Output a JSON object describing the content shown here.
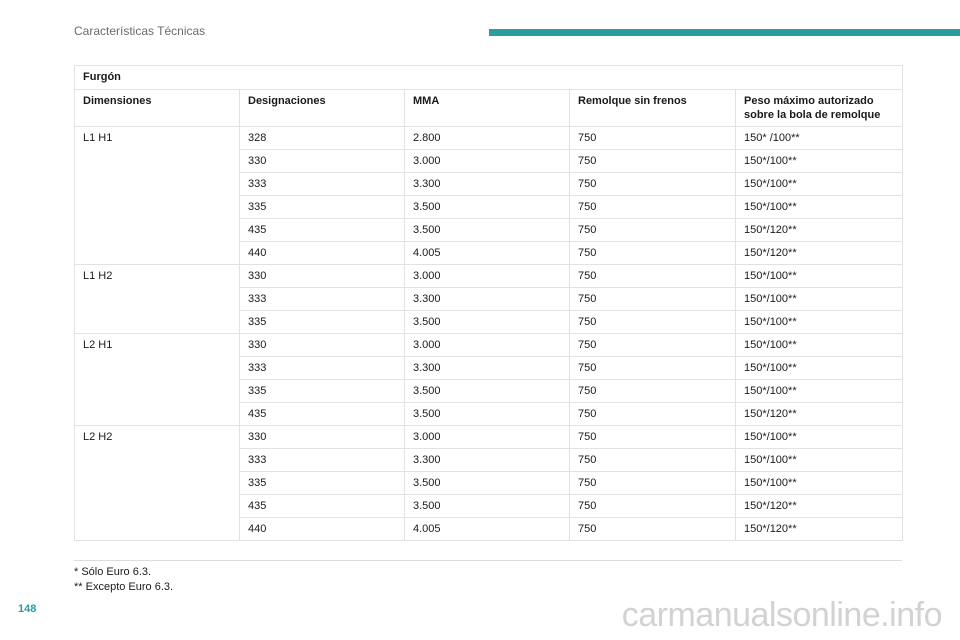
{
  "header": {
    "section_title": "Características Técnicas",
    "accent_color": "#2a9d9d"
  },
  "table": {
    "title": "Furgón",
    "columns": [
      "Dimensiones",
      "Designaciones",
      "MMA",
      "Remolque sin frenos",
      "Peso máximo autorizado sobre la bola de remolque"
    ],
    "groups": [
      {
        "dimension": "L1 H1",
        "rows": [
          [
            "328",
            "2.800",
            "750",
            "150* /100**"
          ],
          [
            "330",
            "3.000",
            "750",
            "150*/100**"
          ],
          [
            "333",
            "3.300",
            "750",
            "150*/100**"
          ],
          [
            "335",
            "3.500",
            "750",
            "150*/100**"
          ],
          [
            "435",
            "3.500",
            "750",
            "150*/120**"
          ],
          [
            "440",
            "4.005",
            "750",
            "150*/120**"
          ]
        ]
      },
      {
        "dimension": "L1 H2",
        "rows": [
          [
            "330",
            "3.000",
            "750",
            "150*/100**"
          ],
          [
            "333",
            "3.300",
            "750",
            "150*/100**"
          ],
          [
            "335",
            "3.500",
            "750",
            "150*/100**"
          ]
        ]
      },
      {
        "dimension": "L2 H1",
        "rows": [
          [
            "330",
            "3.000",
            "750",
            "150*/100**"
          ],
          [
            "333",
            "3.300",
            "750",
            "150*/100**"
          ],
          [
            "335",
            "3.500",
            "750",
            "150*/100**"
          ],
          [
            "435",
            "3.500",
            "750",
            "150*/120**"
          ]
        ]
      },
      {
        "dimension": "L2 H2",
        "rows": [
          [
            "330",
            "3.000",
            "750",
            "150*/100**"
          ],
          [
            "333",
            "3.300",
            "750",
            "150*/100**"
          ],
          [
            "335",
            "3.500",
            "750",
            "150*/100**"
          ],
          [
            "435",
            "3.500",
            "750",
            "150*/120**"
          ],
          [
            "440",
            "4.005",
            "750",
            "150*/120**"
          ]
        ]
      }
    ]
  },
  "footnotes": [
    "* Sólo Euro 6.3.",
    "** Excepto Euro 6.3."
  ],
  "page_number": "148",
  "watermark": "carmanualsonline.info"
}
